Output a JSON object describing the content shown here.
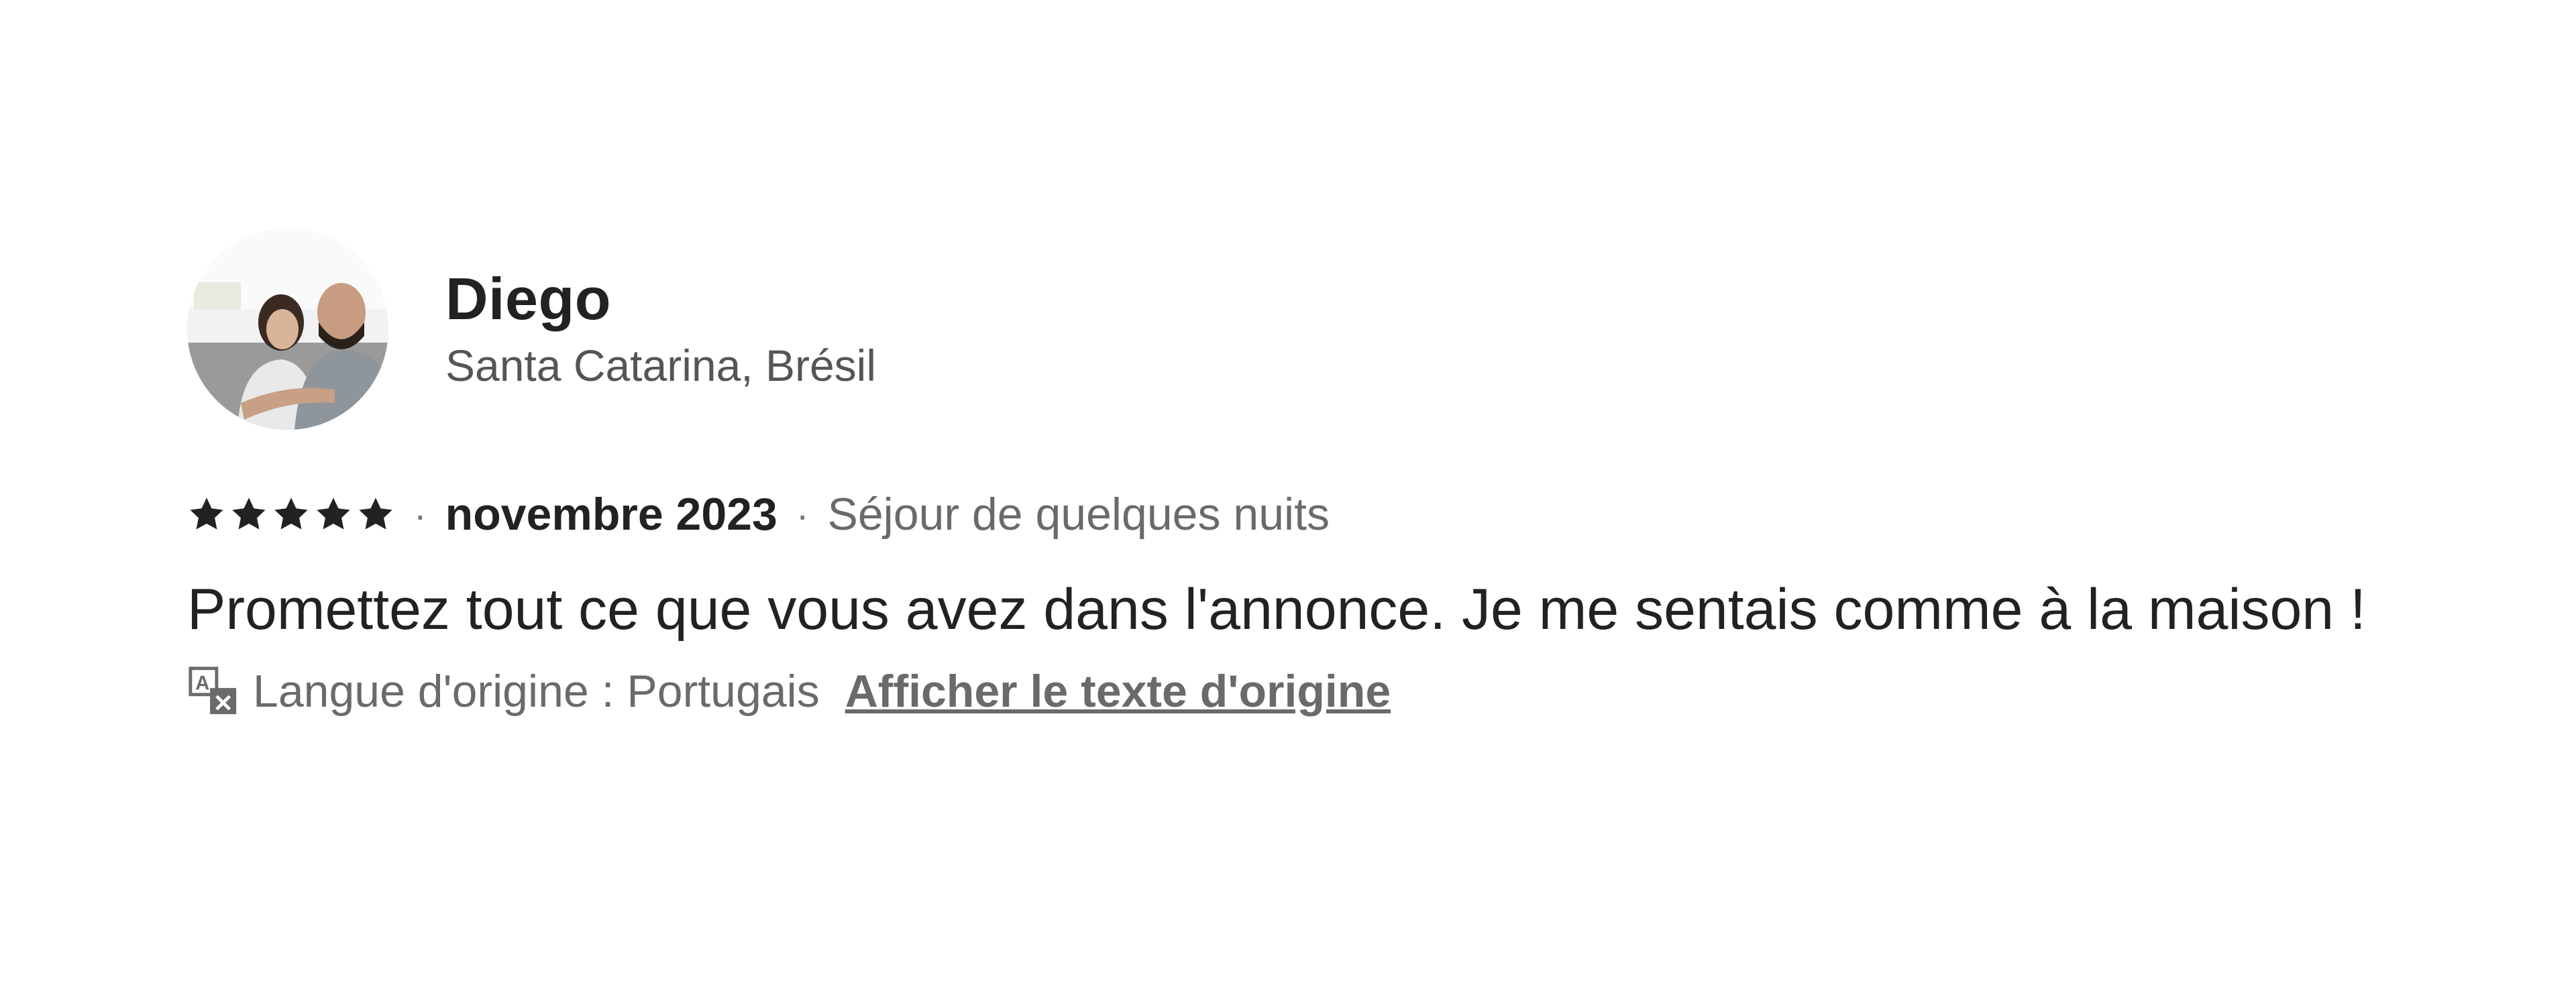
{
  "review": {
    "reviewer": {
      "name": "Diego",
      "location": "Santa Catarina, Brésil",
      "avatar_icon": "reviewer-photo"
    },
    "rating": {
      "stars": 5,
      "max": 5,
      "icon": "star-icon",
      "color": "#222222"
    },
    "separator": "·",
    "date": "novembre 2023",
    "stay_type": "Séjour de quelques nuits",
    "text": "Promettez tout ce que vous avez dans l'annonce. Je me sentais comme à la maison !",
    "translation": {
      "icon": "translate-icon",
      "origin_label": "Langue d'origine : Portugais",
      "show_original_label": "Afficher le texte d'origine"
    }
  }
}
